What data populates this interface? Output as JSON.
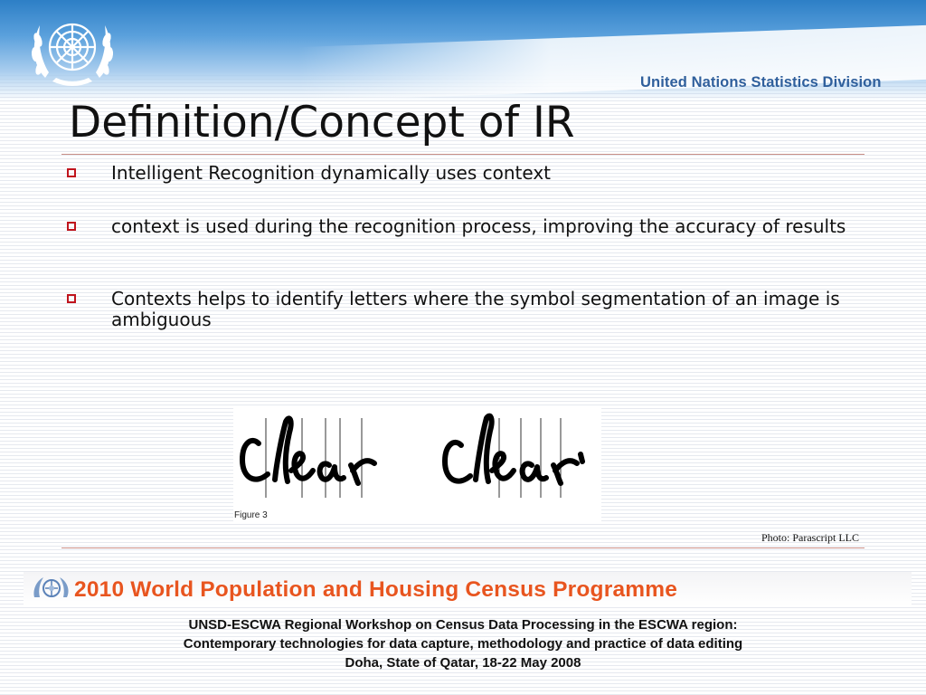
{
  "header": {
    "org_name": "United Nations Statistics Division",
    "logo_icon": "un-emblem-icon"
  },
  "slide": {
    "title": "Definition/Concept of IR",
    "bullets": [
      "Intelligent Recognition dynamically uses context",
      "context is used during the recognition process, improving the accuracy of results",
      "Contexts helps to identify letters where the symbol segmentation of an image is ambiguous"
    ],
    "figure": {
      "caption": "Figure 3",
      "handwritten_words": [
        "Clear",
        "Clear"
      ]
    },
    "photo_credit": "Photo: Parascript LLC"
  },
  "banner": {
    "text": "2010 World Population and Housing Census Programme",
    "logo_icon": "census-programme-logo-icon"
  },
  "footer": {
    "line1": "UNSD-ESCWA Regional Workshop on Census Data Processing in the ESCWA region:",
    "line2": "Contemporary technologies for data capture, methodology and practice of data editing",
    "line3": "Doha, State of Qatar, 18-22 May 2008"
  },
  "colors": {
    "header_blue": "#2d7fc6",
    "unsd_text": "#2f5f9c",
    "bullet_red": "#c0141d",
    "banner_orange": "#e8551f",
    "rule": "#c98e86"
  }
}
